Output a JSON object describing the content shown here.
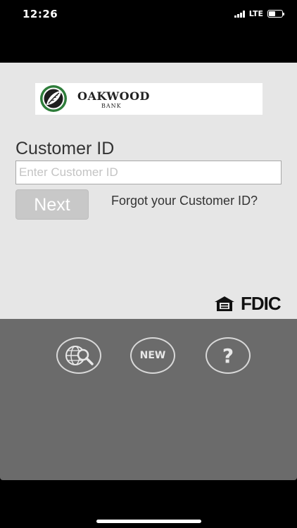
{
  "status": {
    "time": "12:26",
    "network": "LTE"
  },
  "logo": {
    "name": "OAKWOOD",
    "sub": "BANK"
  },
  "form": {
    "label": "Customer ID",
    "placeholder": "Enter Customer ID",
    "value": "",
    "next_label": "Next",
    "forgot_label": "Forgot your Customer ID?"
  },
  "footer": {
    "fdic_label": "FDIC"
  },
  "actions": {
    "new_label": "NEW",
    "help_label": "?"
  },
  "colors": {
    "panel_light": "#e6e6e6",
    "panel_dark": "#6b6b6b",
    "logo_green": "#2e7d3a",
    "button_disabled": "#c8c8c8"
  },
  "icons": [
    "signal-icon",
    "battery-icon",
    "oak-leaf-logo-icon",
    "equal-housing-lender-icon",
    "globe-search-icon"
  ]
}
